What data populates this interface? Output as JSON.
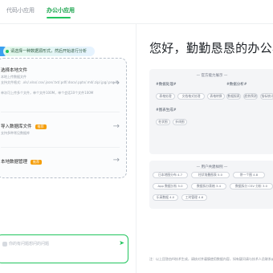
{
  "tabs": [
    {
      "label": "代码小应用"
    },
    {
      "label": "办公小应用"
    }
  ],
  "bot_prompt": "请选择一种数据源形式，然后开始进行分析",
  "options": [
    {
      "title": "选择本地文件",
      "desc1": "本地上传数据文件",
      "desc2": "支持文件格式: .xls/.xlsx/.csv/.json/.txt/.pdf/.docx/.pptx/.md/.zip/.jpg/.png 等格式",
      "desc3": "单次可上传多个文件，单个文件100M，单个会话10个文件100M"
    },
    {
      "title": "导入数据库文件",
      "badge": "推荐",
      "desc1": "支持多种常见数据库"
    },
    {
      "title": "本地数据管理",
      "badge": "推荐"
    }
  ],
  "input_placeholder": "你的有问题想问的问题",
  "greeting": "您好，勤勤恳恳的办公小",
  "card1": {
    "header": "官方能力展示",
    "section1": {
      "label": "#数据处理#",
      "chips": [
        "表格处理",
        "文档格式处理",
        "表格转换"
      ]
    },
    "section2": {
      "label": "#数据分析#",
      "chips": [
        "数据报表",
        "趋势预测",
        "指标统计"
      ]
    },
    "section3": {
      "label": "#图表生成#",
      "chips": [
        "柱状图",
        "折线图"
      ]
    }
  },
  "card2": {
    "header": "用户共建样例",
    "chips": [
      [
        "日本地图分布 4.7",
        "柱状堆叠图表 5.0",
        "饼一个图 4.8"
      ],
      [
        "App 数据分析 5.0",
        "数据拆分表格 3.4",
        "数据拆分 CSV 分析 3.0"
      ],
      [
        "乐高数据 4.0",
        "工时管理 4.6"
      ]
    ]
  },
  "disclaimer": "注：以上回答由AI技术生成，请核对并谨慎使用数据内容，如有疑问请与技术人员联系或提出建议反馈"
}
